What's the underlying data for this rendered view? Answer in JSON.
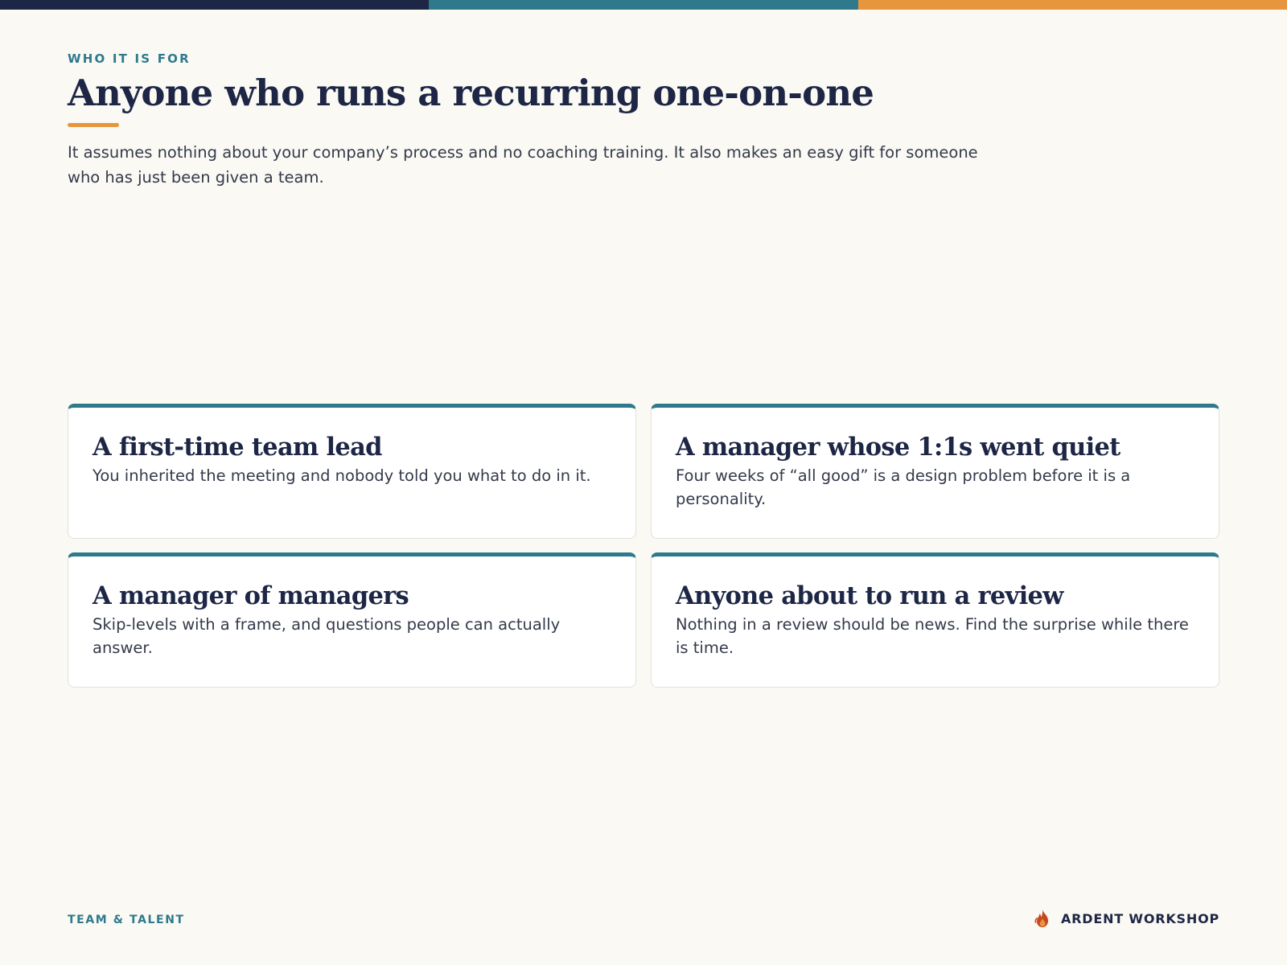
{
  "colors": {
    "background": "#faf9f4",
    "navy": "#1d2645",
    "teal": "#2e7a8c",
    "orange": "#e8963d",
    "flame": "#c8471d"
  },
  "top_bar": {
    "segments": [
      "#1d2645",
      "#2e7a8c",
      "#e8963d"
    ]
  },
  "header": {
    "eyebrow": "WHO IT IS FOR",
    "title": "Anyone who runs a recurring one-on-one",
    "intro": "It assumes nothing about your company’s process and no coaching training. It also makes an easy gift for someone who has just been given a team."
  },
  "cards": [
    {
      "title": "A first-time team lead",
      "body": "You inherited the meeting and nobody told you what to do in it."
    },
    {
      "title": "A manager whose 1:1s went quiet",
      "body": "Four weeks of “all good” is a design problem before it is a personality."
    },
    {
      "title": "A manager of managers",
      "body": "Skip-levels with a frame, and questions people can actually answer."
    },
    {
      "title": "Anyone about to run a review",
      "body": "Nothing in a review should be news. Find the surprise while there is time."
    }
  ],
  "footer": {
    "section": "TEAM & TALENT",
    "brand": "ARDENT WORKSHOP",
    "brand_icon": "flame-logo-icon"
  }
}
